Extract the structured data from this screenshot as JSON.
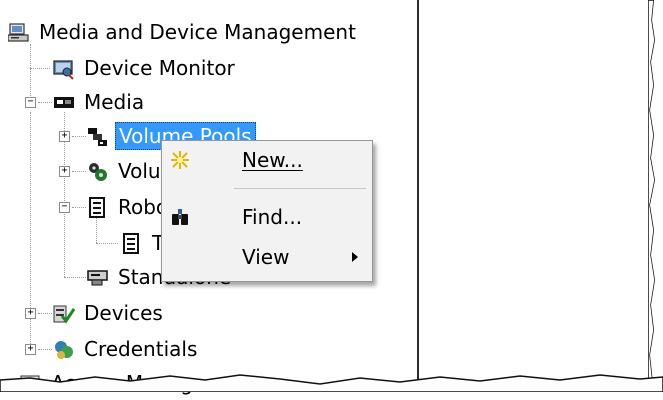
{
  "tree": {
    "root_label": "Media and Device Management",
    "device_monitor_label": "Device Monitor",
    "media_label": "Media",
    "volume_pools_label": "Volume Pools",
    "volume_groups_label": "Volume Groups",
    "robots_label": "Robots",
    "tld_label": "TLD",
    "standalone_label": "Standalone",
    "devices_label": "Devices",
    "credentials_label": "Credentials",
    "access_management_label": "Access Management"
  },
  "context_menu": {
    "new_label": "New...",
    "find_label": "Find...",
    "view_label": "View"
  },
  "icons": {
    "root": "computer-icon",
    "device_monitor": "monitor-icon",
    "media": "tape-icon",
    "volume_pools": "volume-pools-icon",
    "volume_groups": "volume-groups-icon",
    "robots": "robot-icon",
    "tld": "tld-icon",
    "standalone": "drive-icon",
    "devices": "devices-icon",
    "credentials": "credentials-icon",
    "access_management": "access-icon",
    "new": "sparkle-icon",
    "find": "binoculars-icon"
  },
  "colors": {
    "selection": "#3399ff",
    "menu_bg": "#f2f2f2",
    "panel_divider": "#2b2b2b"
  }
}
